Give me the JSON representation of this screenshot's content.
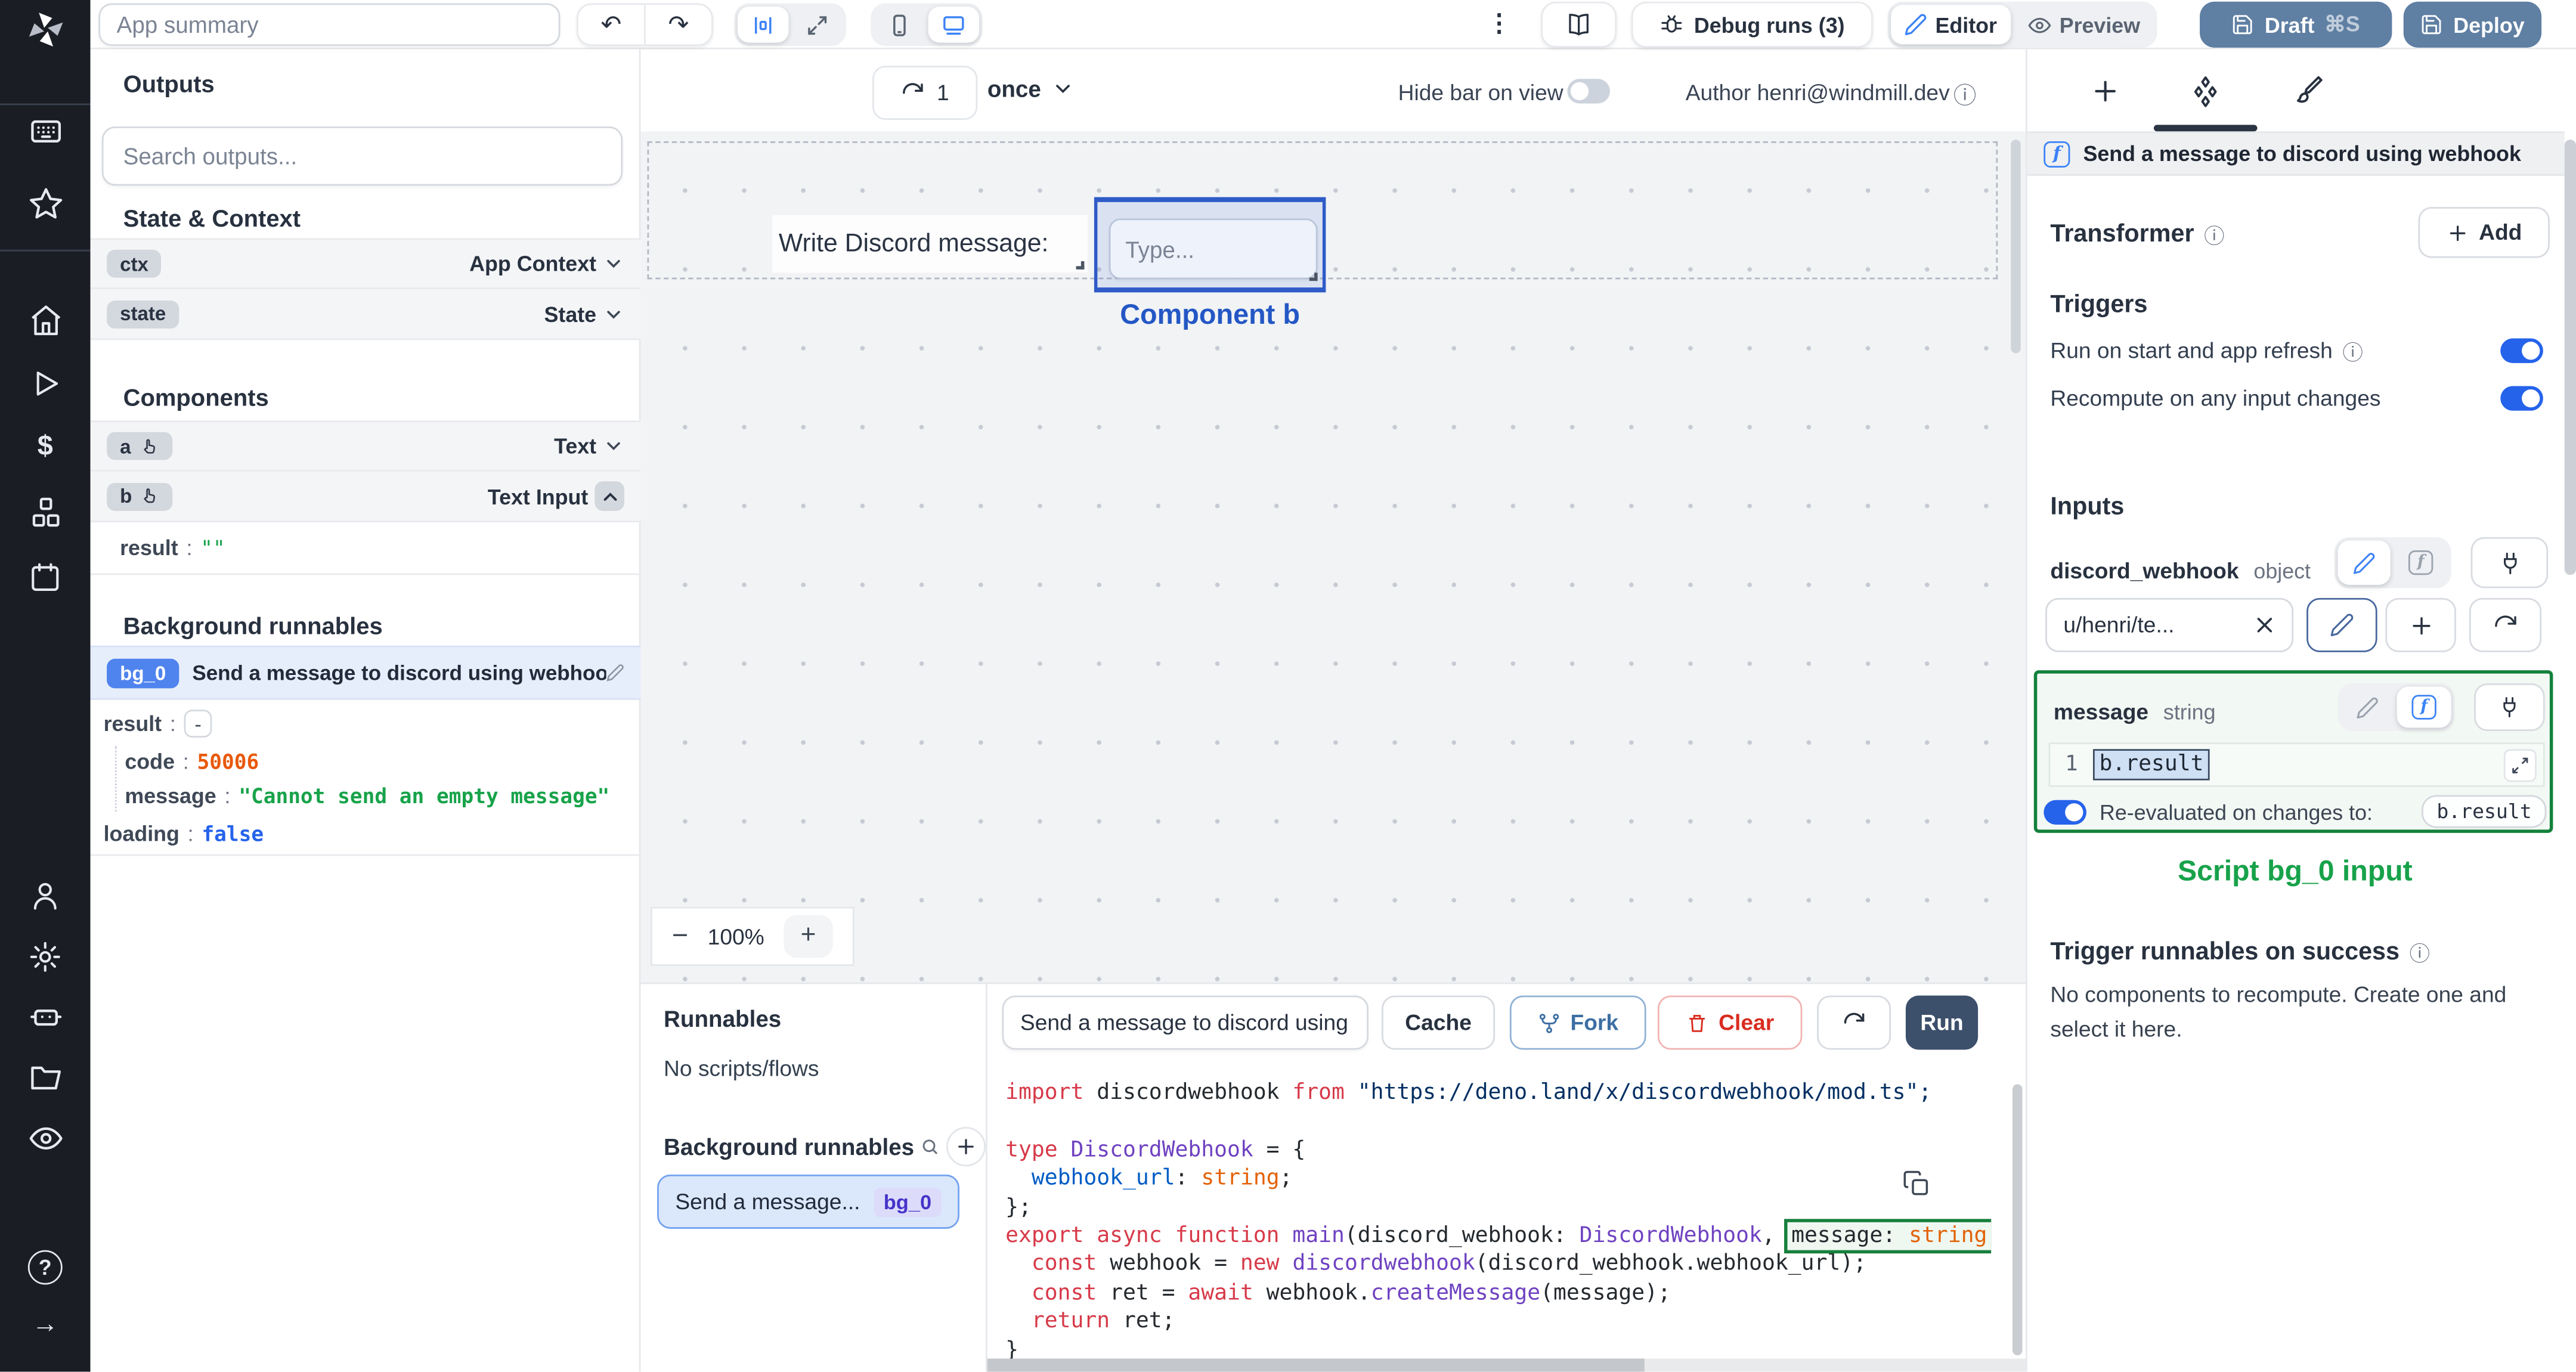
{
  "glyphs": {
    "info": "ⓘ",
    "kebab": "⋮",
    "undo": "↶",
    "redo": "↷",
    "minus": "−",
    "plus": "+",
    "collapse": "-",
    "question": "?",
    "arrow_right": "→",
    "dollar": "$",
    "colon": ":"
  },
  "colors": {
    "accent": "#3b82f6",
    "selection_blue": "#2e5bc7",
    "success_green": "#16a34a",
    "danger_red": "#dc2626",
    "draft_deploy_blue": "#5f7fa3",
    "run_navy": "#3c4f6b",
    "json_number": "#e8590c",
    "json_string": "#18a34a",
    "json_boolean": "#2563eb"
  },
  "topbar": {
    "app_summary_placeholder": "App summary",
    "debug_runs": "Debug runs (3)",
    "editor": "Editor",
    "preview": "Preview",
    "draft": "Draft",
    "draft_shortcut": "⌘S",
    "deploy": "Deploy"
  },
  "outputs_panel": {
    "title": "Outputs",
    "search_placeholder": "Search outputs...",
    "sections": {
      "state": "State & Context",
      "components": "Components",
      "background": "Background runnables"
    },
    "state_rows": [
      {
        "key": "ctx",
        "type": "App Context"
      },
      {
        "key": "state",
        "type": "State"
      }
    ],
    "component_rows": [
      {
        "key": "a",
        "type": "Text"
      },
      {
        "key": "b",
        "type": "Text Input"
      }
    ],
    "b_result": {
      "key": "result",
      "value": "\"\""
    },
    "bg": {
      "badge": "bg_0",
      "label": "Send a message to discord using webhook",
      "result_key": "result",
      "code_key": "code",
      "code_value": "50006",
      "message_key": "message",
      "message_value": "\"Cannot send an empty message\"",
      "loading_key": "loading",
      "loading_value": "false"
    }
  },
  "canvas": {
    "refresh_count": "1",
    "frequency": "once",
    "hide_bar_label": "Hide bar on view",
    "author_label": "Author henri@windmill.dev",
    "text_component": "Write Discord message:",
    "input_placeholder": "Type...",
    "selected_component_label": "Component b",
    "zoom_level": "100%"
  },
  "runnables_panel": {
    "title": "Runnables",
    "empty": "No scripts/flows",
    "bg_title": "Background runnables",
    "item": {
      "label": "Send a message...",
      "badge": "bg_0"
    }
  },
  "runner": {
    "name": "Send a message to discord using",
    "cache": "Cache",
    "fork": "Fork",
    "clear": "Clear",
    "run": "Run",
    "code": [
      [
        {
          "c": "k",
          "t": "import "
        },
        {
          "c": "d",
          "t": "discordwebhook "
        },
        {
          "c": "k",
          "t": "from "
        },
        {
          "c": "s",
          "t": "\"https://deno.land/x/discordwebhook/mod.ts\";"
        }
      ],
      [
        {
          "c": "d",
          "t": " "
        }
      ],
      [
        {
          "c": "k",
          "t": "type "
        },
        {
          "c": "t",
          "t": "DiscordWebhook"
        },
        {
          "c": "d",
          "t": " = {"
        }
      ],
      [
        {
          "c": "d",
          "t": "  "
        },
        {
          "c": "p",
          "t": "webhook_url"
        },
        {
          "c": "d",
          "t": ": "
        },
        {
          "c": "o",
          "t": "string"
        },
        {
          "c": "d",
          "t": ";"
        }
      ],
      [
        {
          "c": "d",
          "t": "};"
        }
      ],
      [
        {
          "c": "k",
          "t": "export async function "
        },
        {
          "c": "t",
          "t": "main"
        },
        {
          "c": "d",
          "t": "(discord_webhook: "
        },
        {
          "c": "t",
          "t": "DiscordWebhook"
        },
        {
          "c": "d",
          "t": ", "
        },
        {
          "box": true,
          "segs": [
            {
              "c": "d",
              "t": "message: "
            },
            {
              "c": "o",
              "t": "string"
            }
          ]
        }
      ],
      [
        {
          "c": "d",
          "t": "  "
        },
        {
          "c": "k",
          "t": "const"
        },
        {
          "c": "d",
          "t": " webhook = "
        },
        {
          "c": "k",
          "t": "new"
        },
        {
          "c": "d",
          "t": " "
        },
        {
          "c": "t",
          "t": "discordwebhook"
        },
        {
          "c": "d",
          "t": "(discord_webhook.webhook_url);"
        }
      ],
      [
        {
          "c": "d",
          "t": "  "
        },
        {
          "c": "k",
          "t": "const"
        },
        {
          "c": "d",
          "t": " ret = "
        },
        {
          "c": "k",
          "t": "await"
        },
        {
          "c": "d",
          "t": " webhook."
        },
        {
          "c": "t",
          "t": "createMessage"
        },
        {
          "c": "d",
          "t": "(message);"
        }
      ],
      [
        {
          "c": "d",
          "t": "  "
        },
        {
          "c": "k",
          "t": "return"
        },
        {
          "c": "d",
          "t": " ret;"
        }
      ],
      [
        {
          "c": "d",
          "t": "}"
        }
      ]
    ]
  },
  "inspector": {
    "header": "Send a message to discord using webhook",
    "fn_glyph": "f",
    "transformer_label": "Transformer",
    "add_label": "Add",
    "triggers_title": "Triggers",
    "trigger_rows": [
      {
        "label": "Run on start and app refresh"
      },
      {
        "label": "Recompute on any input changes"
      }
    ],
    "inputs_title": "Inputs",
    "discord_webhook": {
      "name": "discord_webhook",
      "type": "object",
      "value": "u/henri/te..."
    },
    "message": {
      "name": "message",
      "type": "string",
      "line_no": "1",
      "expr": "b.result",
      "reeval_label": "Re-evaluated on changes to:",
      "reeval_target": "b.result"
    },
    "script_input_label": "Script bg_0 input",
    "on_success_title": "Trigger runnables on success",
    "on_success_empty": "No components to recompute. Create one and select it here."
  }
}
